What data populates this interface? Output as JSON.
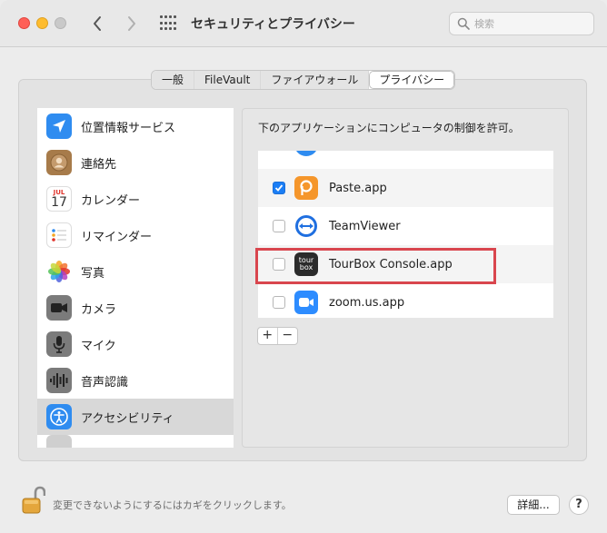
{
  "window": {
    "title": "セキュリティとプライバシー",
    "search_placeholder": "検索"
  },
  "tabs": [
    {
      "label": "一般",
      "active": false
    },
    {
      "label": "FileVault",
      "active": false
    },
    {
      "label": "ファイアウォール",
      "active": false
    },
    {
      "label": "プライバシー",
      "active": true
    }
  ],
  "sidebar": {
    "items": [
      {
        "label": "位置情報サービス",
        "icon": "location-arrow-icon",
        "selected": false
      },
      {
        "label": "連絡先",
        "icon": "contacts-icon",
        "selected": false
      },
      {
        "label": "カレンダー",
        "icon": "calendar-icon",
        "selected": false,
        "calendar_month": "JUL",
        "calendar_day": "17"
      },
      {
        "label": "リマインダー",
        "icon": "reminders-icon",
        "selected": false
      },
      {
        "label": "写真",
        "icon": "photos-icon",
        "selected": false
      },
      {
        "label": "カメラ",
        "icon": "camera-icon",
        "selected": false
      },
      {
        "label": "マイク",
        "icon": "microphone-icon",
        "selected": false
      },
      {
        "label": "音声認識",
        "icon": "speech-recognition-icon",
        "selected": false
      },
      {
        "label": "アクセシビリティ",
        "icon": "accessibility-icon",
        "selected": true
      }
    ]
  },
  "main": {
    "caption": "下のアプリケーションにコンピュータの制御を許可。",
    "apps": [
      {
        "label": "Paste.app",
        "checked": true,
        "icon": "paste-app-icon"
      },
      {
        "label": "TeamViewer",
        "checked": false,
        "icon": "teamviewer-icon"
      },
      {
        "label": "TourBox Console.app",
        "checked": false,
        "icon": "tourbox-icon",
        "icon_text_top": "tour",
        "icon_text_bottom": "box"
      },
      {
        "label": "zoom.us.app",
        "checked": false,
        "icon": "zoom-icon"
      }
    ],
    "add_label": "+",
    "remove_label": "−"
  },
  "footer": {
    "lock_text": "変更できないようにするにはカギをクリックします。",
    "advanced_label": "詳細...",
    "help_label": "?"
  },
  "colors": {
    "accent": "#1b7ef5",
    "highlight_box": "#d9464e"
  }
}
